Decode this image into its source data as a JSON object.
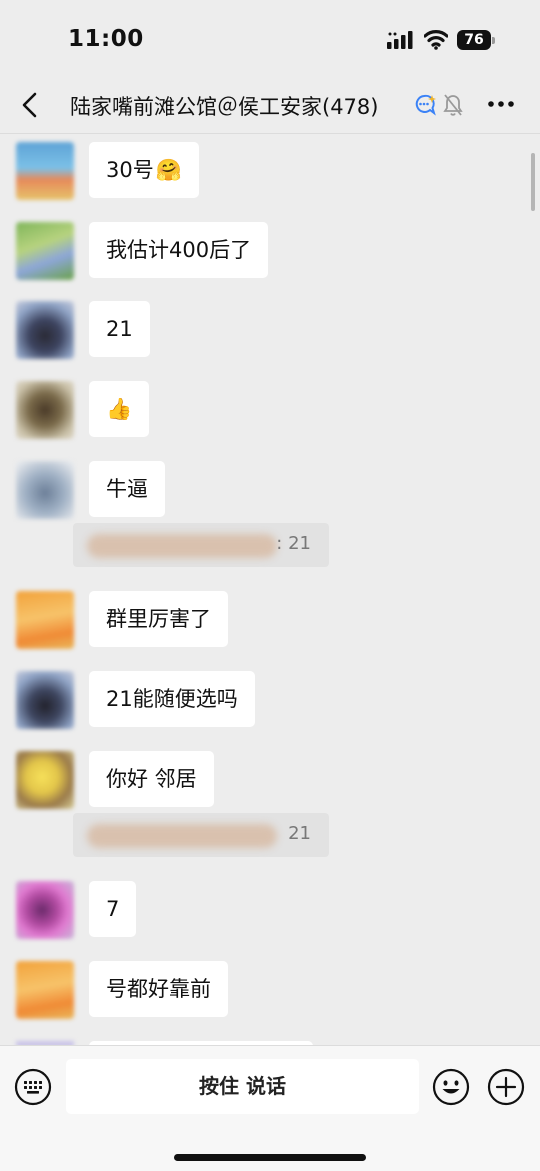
{
  "status_bar": {
    "time": "11:00",
    "battery": "76"
  },
  "nav": {
    "title": "陆家嘴前滩公馆＠侯工安家(478)"
  },
  "messages": [
    {
      "text": "30号",
      "emoji": "🤗"
    },
    {
      "text": "我估计400后了"
    },
    {
      "text": "21"
    },
    {
      "text": "",
      "emoji": "👍"
    },
    {
      "text": "牛逼",
      "quote": ": 21"
    },
    {
      "text": "群里厉害了"
    },
    {
      "text": "21能随便选吗"
    },
    {
      "text": "你好 邻居",
      "quote": "21"
    },
    {
      "text": "7"
    },
    {
      "text": "号都好靠前"
    }
  ],
  "input": {
    "hold_to_talk": "按住 说话"
  },
  "colors": {
    "background": "#ededed",
    "bubble": "#ffffff",
    "quote": "#e2e2e2"
  }
}
